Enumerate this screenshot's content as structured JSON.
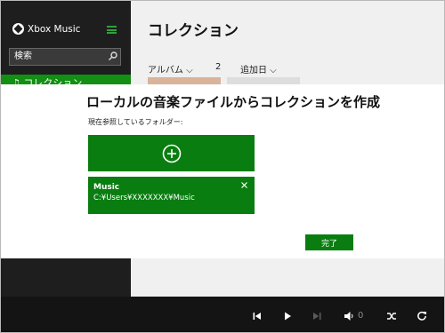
{
  "app": {
    "name": "Xbox Music"
  },
  "sidebar": {
    "search": {
      "value": "検索"
    },
    "active_item": "コレクション"
  },
  "main": {
    "title": "コレクション",
    "filters": {
      "album": "アルバム ⌵",
      "count": "2",
      "added": "追加日 ⌵"
    }
  },
  "modal": {
    "title": "ローカルの音楽ファイルからコレクションを作成",
    "subtitle": "現在参照しているフォルダー:",
    "folders": [
      {
        "name": "Music",
        "path": "C:¥Users¥XXXXXXX¥Music"
      }
    ],
    "done_label": "完了"
  },
  "player": {
    "volume": "0"
  },
  "colors": {
    "accent": "#0a7d11",
    "sidebar": "#1e1e1e",
    "bottom_bar": "#141414"
  }
}
